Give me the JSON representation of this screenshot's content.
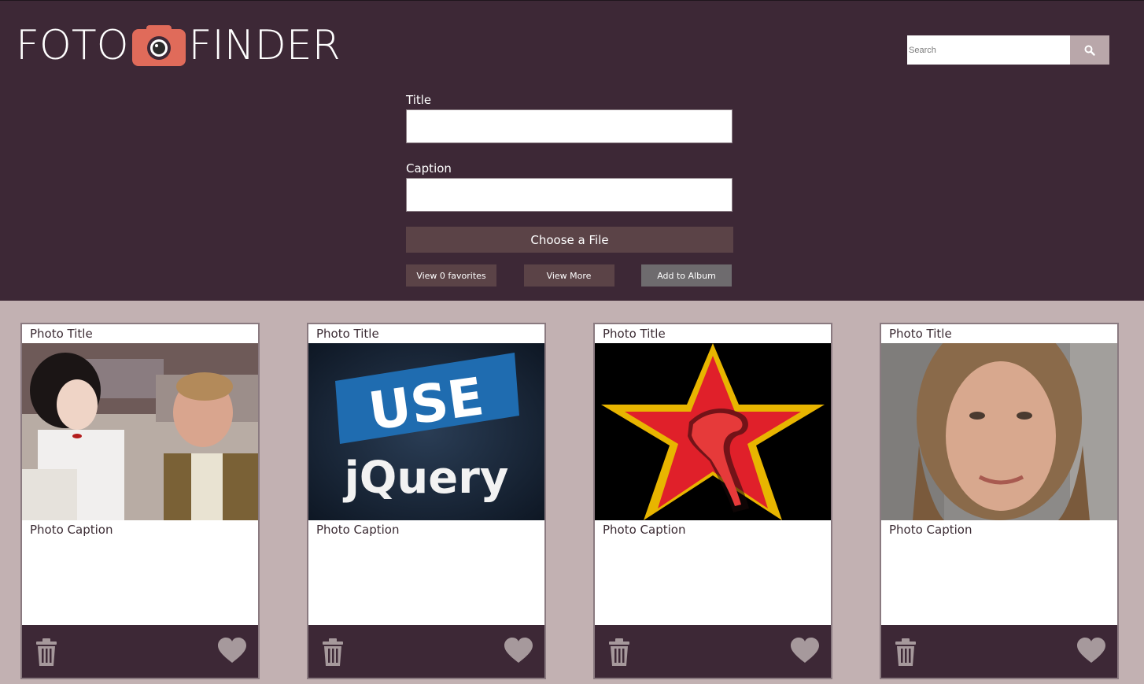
{
  "app": {
    "logo_left": "FOTO",
    "logo_right": "FINDER"
  },
  "search": {
    "placeholder": "Search"
  },
  "form": {
    "title_label": "Title",
    "caption_label": "Caption",
    "choose_file_label": "Choose a File",
    "view_favorites_label": "View 0 favorites",
    "view_more_label": "View More",
    "add_album_label": "Add to Album"
  },
  "cards": [
    {
      "title": "Photo Title",
      "caption": "Photo Caption",
      "image": "photo-two-people-lab"
    },
    {
      "title": "Photo Title",
      "caption": "Photo Caption",
      "image": "photo-use-jquery",
      "image_text_top": "USE",
      "image_text_bottom": "jQuery"
    },
    {
      "title": "Photo Title",
      "caption": "Photo Caption",
      "image": "photo-red-star-dinosaur"
    },
    {
      "title": "Photo Title",
      "caption": "Photo Caption",
      "image": "photo-woman-portrait"
    }
  ],
  "colors": {
    "header_bg": "#3d2836",
    "page_bg": "#c2b1b2",
    "camera_accent": "#e06b5a",
    "button_bg": "#5b4347",
    "add_button_bg": "#6e6b6e",
    "icon_color": "#a6999c"
  },
  "icons": [
    "camera-icon",
    "search-icon",
    "trash-icon",
    "heart-icon"
  ]
}
